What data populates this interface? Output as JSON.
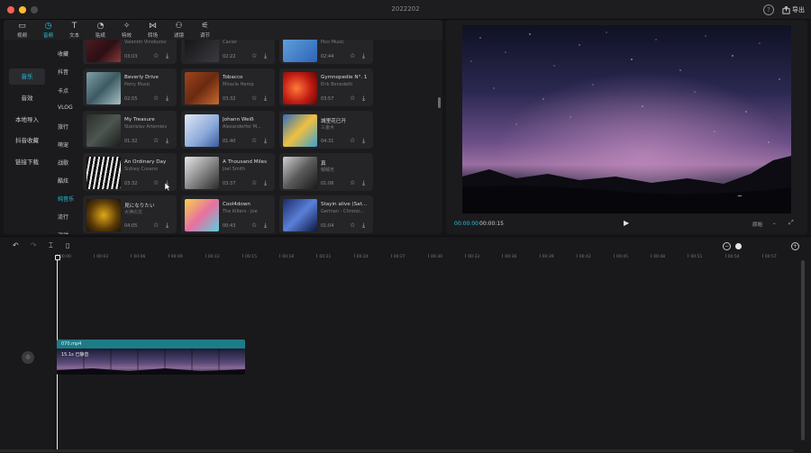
{
  "window": {
    "title": "2022202",
    "help": "?",
    "export_label": "导出"
  },
  "toolbar": {
    "tabs": [
      {
        "label": "视频",
        "icon": "video-icon"
      },
      {
        "label": "音频",
        "icon": "audio-icon"
      },
      {
        "label": "文本",
        "icon": "text-icon"
      },
      {
        "label": "贴纸",
        "icon": "sticker-icon"
      },
      {
        "label": "特效",
        "icon": "effects-icon"
      },
      {
        "label": "转场",
        "icon": "transition-icon"
      },
      {
        "label": "滤镜",
        "icon": "filter-icon"
      },
      {
        "label": "调节",
        "icon": "adjust-icon"
      }
    ]
  },
  "sidebar": {
    "items": [
      {
        "label": "音乐"
      },
      {
        "label": "音效"
      },
      {
        "label": "本地导入"
      },
      {
        "label": "抖音收藏"
      },
      {
        "label": "链接下载"
      }
    ]
  },
  "categories": [
    "收藏",
    "抖音",
    "卡点",
    "VLOG",
    "旅行",
    "萌宠",
    "战歌",
    "酷炫",
    "纯音乐",
    "流行",
    "运动"
  ],
  "cards": [
    {
      "title": "",
      "artist": "Valentin Vinokurov",
      "duration": "03:03"
    },
    {
      "title": "",
      "artist": "Caviar",
      "duration": "02:22"
    },
    {
      "title": "",
      "artist": "Pico Music",
      "duration": "02:44"
    },
    {
      "title": "Beverly Drive",
      "artist": "Perry Music",
      "duration": "02:55"
    },
    {
      "title": "Tobacco",
      "artist": "Miracle Hemp",
      "duration": "03:32"
    },
    {
      "title": "Gymnopedie N°. 1",
      "artist": "Erik Benedetti",
      "duration": "03:57"
    },
    {
      "title": "My Treasure",
      "artist": "Stanislav Artemiev",
      "duration": "01:32"
    },
    {
      "title": "Johann Weiß",
      "artist": "Alexanderfer M...",
      "duration": "01:40"
    },
    {
      "title": "城里花已开",
      "artist": "三金木",
      "duration": "04:31"
    },
    {
      "title": "An Ordinary Day",
      "artist": "Sidney Cosano",
      "duration": "03:32"
    },
    {
      "title": "A Thousand Miles",
      "artist": "Joel Smith",
      "duration": "03:37"
    },
    {
      "title": "真",
      "artist": "郁郁无",
      "duration": "01:06"
    },
    {
      "title": "見になりたい",
      "artist": "大神の文",
      "duration": "04:05"
    },
    {
      "title": "Cool4down",
      "artist": "The Killers - Joe",
      "duration": "00:43"
    },
    {
      "title": "Stayin alive (Sat...",
      "artist": "German - Chronic...",
      "duration": "01:04"
    }
  ],
  "preview": {
    "current_time": "00:00:00",
    "total_time": "00:00:15",
    "ratio_label": "原始",
    "ratio_chevron": "⌄"
  },
  "timeline": {
    "ticks": [
      "00:00",
      "00:03",
      "00:06",
      "00:09",
      "00:12",
      "00:15",
      "00:18",
      "00:21",
      "00:24",
      "00:27",
      "00:30",
      "00:33",
      "00:36",
      "00:39",
      "00:42",
      "00:45",
      "00:48",
      "00:51",
      "00:54",
      "00:57"
    ],
    "clip": {
      "name": "070.mp4",
      "info": "15.1s  已静音"
    }
  }
}
